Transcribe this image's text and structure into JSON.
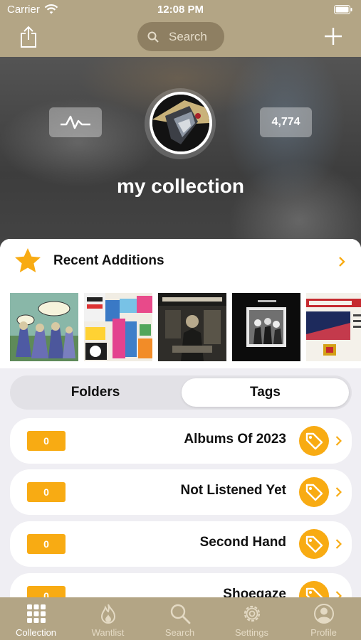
{
  "status": {
    "carrier": "Carrier",
    "time": "12:08 PM"
  },
  "header": {
    "search_placeholder": "Search"
  },
  "hero": {
    "item_count": "4,774",
    "title": "my collection"
  },
  "recent": {
    "label": "Recent Additions"
  },
  "segment": {
    "folders": "Folders",
    "tags": "Tags",
    "selected": "Tags"
  },
  "tags": [
    {
      "name": "Albums Of 2023",
      "count": "0"
    },
    {
      "name": "Not Listened Yet",
      "count": "0"
    },
    {
      "name": "Second Hand",
      "count": "0"
    },
    {
      "name": "Shoegaze",
      "count": "0"
    }
  ],
  "tabs": [
    {
      "label": "Collection",
      "icon": "grid-icon",
      "active": true
    },
    {
      "label": "Wantlist",
      "icon": "flame-icon",
      "active": false
    },
    {
      "label": "Search",
      "icon": "magnifier-icon",
      "active": false
    },
    {
      "label": "Settings",
      "icon": "gear-icon",
      "active": false
    },
    {
      "label": "Profile",
      "icon": "person-icon",
      "active": false
    }
  ],
  "colors": {
    "brand": "#b3a585",
    "accent": "#f8ab13",
    "background": "#efeef3"
  }
}
